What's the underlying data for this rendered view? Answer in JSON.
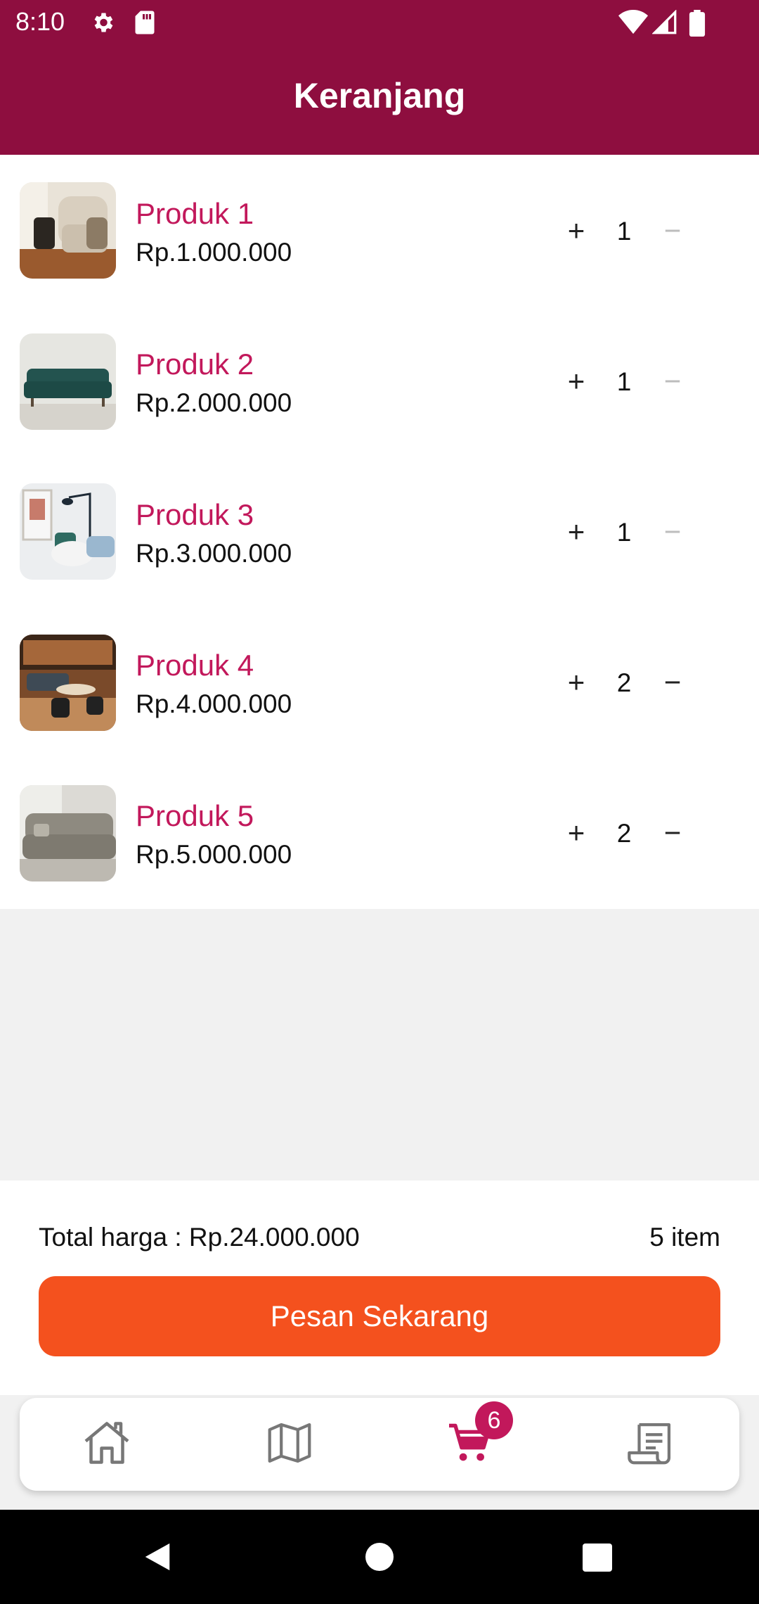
{
  "status": {
    "time": "8:10"
  },
  "header": {
    "title": "Keranjang"
  },
  "cart": {
    "items": [
      {
        "name": "Produk 1",
        "price": "Rp.1.000.000",
        "qty": "1",
        "minus_enabled": false
      },
      {
        "name": "Produk 2",
        "price": "Rp.2.000.000",
        "qty": "1",
        "minus_enabled": false
      },
      {
        "name": "Produk 3",
        "price": "Rp.3.000.000",
        "qty": "1",
        "minus_enabled": false
      },
      {
        "name": "Produk 4",
        "price": "Rp.4.000.000",
        "qty": "2",
        "minus_enabled": true
      },
      {
        "name": "Produk 5",
        "price": "Rp.5.000.000",
        "qty": "2",
        "minus_enabled": true
      }
    ],
    "plus_symbol": "+",
    "minus_symbol": "−"
  },
  "summary": {
    "total": "Total harga : Rp.24.000.000",
    "count": "5 item",
    "order_button": "Pesan Sekarang"
  },
  "nav": {
    "items": [
      {
        "icon": "home-icon"
      },
      {
        "icon": "map-icon"
      },
      {
        "icon": "cart-icon",
        "active": true,
        "badge": "6"
      },
      {
        "icon": "receipt-icon"
      }
    ]
  },
  "colors": {
    "primary": "#8e0e3f",
    "accent": "#c2185b",
    "button": "#f4511e"
  }
}
